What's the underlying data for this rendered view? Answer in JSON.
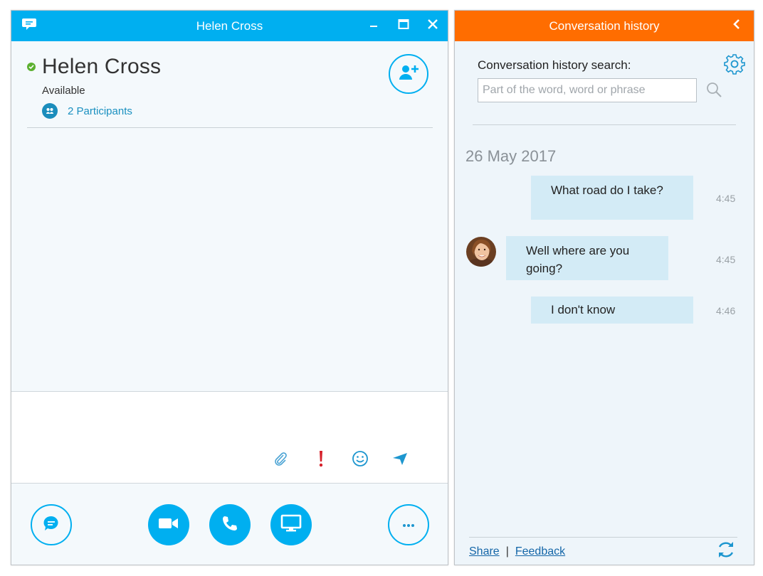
{
  "chat_window": {
    "title": "Helen Cross",
    "contact": {
      "name": "Helen Cross",
      "status": "Available",
      "participants_label": "2 Participants"
    },
    "icons": {
      "titlebar": "chat-bubble-icon",
      "minimize": "minimize-icon",
      "maximize": "maximize-icon",
      "close": "close-icon",
      "add_person": "add-person-icon",
      "participants": "participants-icon",
      "attach": "paperclip-icon",
      "importance": "exclamation-icon",
      "emoticon": "smiley-icon",
      "send": "send-icon",
      "im": "im-icon",
      "video": "video-camera-icon",
      "call": "phone-icon",
      "present": "monitor-icon",
      "more": "more-options-icon"
    }
  },
  "history_panel": {
    "title": "Conversation history",
    "search_label": "Conversation history search:",
    "search_placeholder": "Part of the word, word or phrase",
    "date": "26 May 2017",
    "messages": [
      {
        "text": "What road do I take?",
        "time": "4:45",
        "sender": "self"
      },
      {
        "text": "Well where are you going?",
        "time": "4:45",
        "sender": "contact"
      },
      {
        "text": "I don't know",
        "time": "4:46",
        "sender": "self"
      }
    ],
    "footer": {
      "share": "Share",
      "separator": "|",
      "feedback": "Feedback"
    },
    "icons": {
      "back": "chevron-left-icon",
      "settings": "gear-icon",
      "search": "search-icon",
      "refresh": "refresh-icon"
    }
  },
  "colors": {
    "skype_blue": "#00aff0",
    "history_orange": "#ff6d00",
    "bubble_blue": "#d3ebf6",
    "presence_green": "#5cb030",
    "link_blue": "#1466a8"
  }
}
